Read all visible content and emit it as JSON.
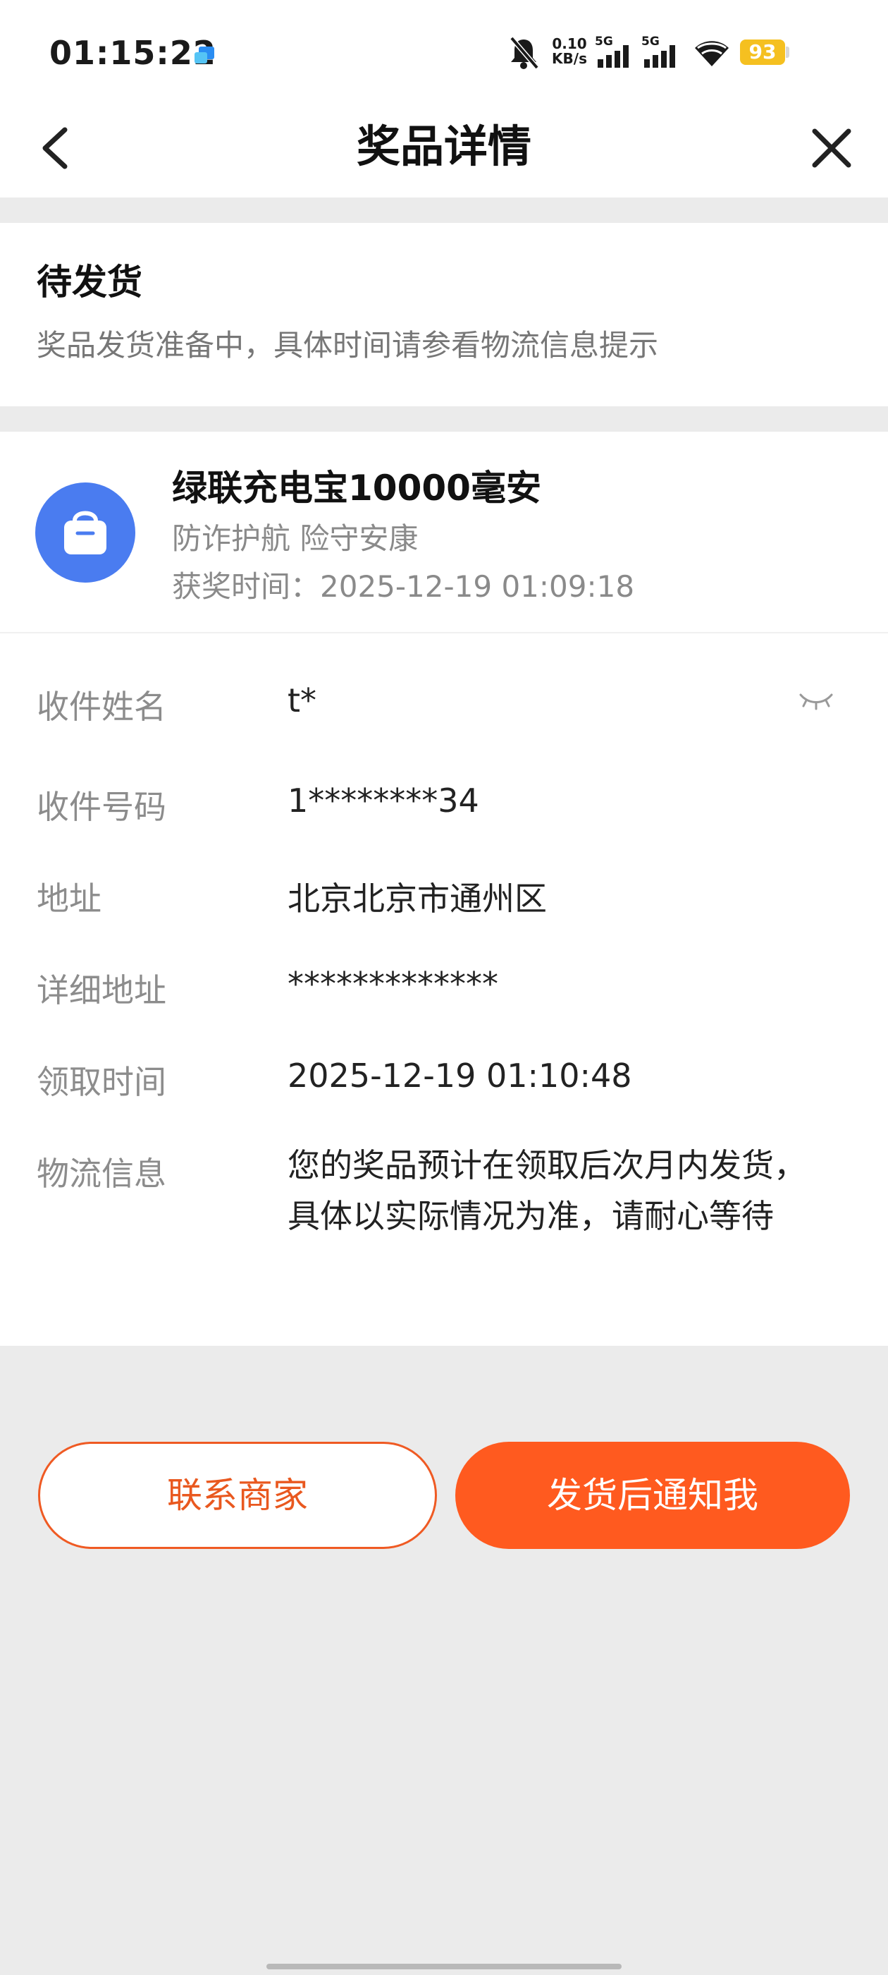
{
  "status_bar": {
    "time": "01:15:22",
    "net_speed_value": "0.10",
    "net_speed_unit": "KB/s",
    "sim1_label": "5G",
    "sim2_label": "5G",
    "battery": "93",
    "icons": [
      "app-notification-icon",
      "mute-bell-icon",
      "signal-icon",
      "wifi-icon",
      "battery-icon"
    ]
  },
  "header": {
    "title": "奖品详情",
    "back_icon": "chevron-left-icon",
    "close_icon": "close-icon"
  },
  "status_card": {
    "title": "待发货",
    "description": "奖品发货准备中，具体时间请参看物流信息提示"
  },
  "prize": {
    "name": "绿联充电宝10000毫安",
    "slogan": "防诈护航 险守安康",
    "time_label": "获奖时间：",
    "time_value": "2025-12-19 01:09:18",
    "icon": "shopping-bag-icon",
    "icon_color": "#4a7cf0"
  },
  "info": {
    "recipient_name_label": "收件姓名",
    "recipient_name_value": "t*",
    "recipient_phone_label": "收件号码",
    "recipient_phone_value": "1********34",
    "address_label": "地址",
    "address_value": "北京北京市通州区",
    "detail_address_label": "详细地址",
    "detail_address_value": "*************",
    "claim_time_label": "领取时间",
    "claim_time_value": "2025-12-19 01:10:48",
    "logistics_label": "物流信息",
    "logistics_value": "您的奖品预计在领取后次月内发货，具体以实际情况为准，请耐心等待"
  },
  "buttons": {
    "contact_label": "联系商家",
    "notify_label": "发货后通知我"
  },
  "colors": {
    "accent": "#ff5a1f",
    "accent_text": "#e9581f",
    "page_bg": "#ebebeb"
  }
}
